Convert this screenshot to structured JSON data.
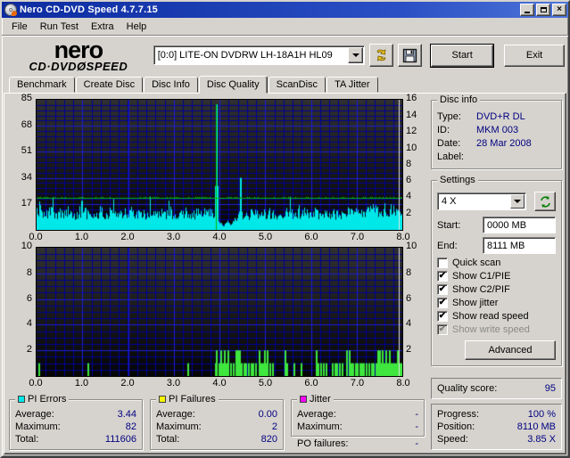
{
  "window": {
    "title": "Nero CD-DVD Speed 4.7.7.15"
  },
  "menu": {
    "items": [
      {
        "label": "File"
      },
      {
        "label": "Run Test"
      },
      {
        "label": "Extra"
      },
      {
        "label": "Help"
      }
    ]
  },
  "toolbar": {
    "logo_line1": "nero",
    "logo_line2": "CD·DVDØSPEED",
    "drive_selected": "[0:0]   LITE-ON DVDRW LH-18A1H HL09",
    "start_label": "Start",
    "exit_label": "Exit"
  },
  "tabs": [
    {
      "label": "Benchmark",
      "active": false
    },
    {
      "label": "Create Disc",
      "active": false
    },
    {
      "label": "Disc Info",
      "active": false
    },
    {
      "label": "Disc Quality",
      "active": true
    },
    {
      "label": "ScanDisc",
      "active": false
    },
    {
      "label": "TA Jitter",
      "active": false
    }
  ],
  "disc_info": {
    "title": "Disc info",
    "rows": [
      {
        "label": "Type:",
        "value": "DVD+R DL"
      },
      {
        "label": "ID:",
        "value": "MKM 003"
      },
      {
        "label": "Date:",
        "value": "28 Mar 2008"
      },
      {
        "label": "Label:",
        "value": ""
      }
    ]
  },
  "settings": {
    "title": "Settings",
    "speed_selected": "4 X",
    "start_label": "Start:",
    "start_value": "0000 MB",
    "end_label": "End:",
    "end_value": "8111 MB",
    "checkboxes": [
      {
        "label": "Quick scan",
        "state": "unchecked"
      },
      {
        "label": "Show C1/PIE",
        "state": "checked"
      },
      {
        "label": "Show C2/PIF",
        "state": "checked"
      },
      {
        "label": "Show jitter",
        "state": "checked"
      },
      {
        "label": "Show read speed",
        "state": "checked"
      },
      {
        "label": "Show write speed",
        "state": "checked-disabled"
      }
    ],
    "advanced_label": "Advanced"
  },
  "quality": {
    "label": "Quality score:",
    "value": "95"
  },
  "progress": {
    "rows": [
      {
        "label": "Progress:",
        "value": "100 %"
      },
      {
        "label": "Position:",
        "value": "8110 MB"
      },
      {
        "label": "Speed:",
        "value": "3.85 X"
      }
    ]
  },
  "stats": {
    "pi_errors": {
      "title": "PI Errors",
      "color": "#00e8e8",
      "rows": [
        {
          "label": "Average:",
          "value": "3.44"
        },
        {
          "label": "Maximum:",
          "value": "82"
        },
        {
          "label": "Total:",
          "value": "111606"
        }
      ]
    },
    "pi_failures": {
      "title": "PI Failures",
      "color": "#f5f500",
      "rows": [
        {
          "label": "Average:",
          "value": "0.00"
        },
        {
          "label": "Maximum:",
          "value": "2"
        },
        {
          "label": "Total:",
          "value": "820"
        }
      ]
    },
    "jitter": {
      "title": "Jitter",
      "color": "#f500f5",
      "rows": [
        {
          "label": "Average:",
          "value": "-"
        },
        {
          "label": "Maximum:",
          "value": "-"
        }
      ],
      "po_label": "PO failures:",
      "po_value": "-"
    }
  },
  "chart_data": [
    {
      "type": "area",
      "name": "PI Errors scan trace",
      "x": {
        "min": 0,
        "max": 8,
        "minor_step": 0.2,
        "major_step": 1,
        "tick_labels": [
          "0.0",
          "1.0",
          "2.0",
          "3.0",
          "4.0",
          "5.0",
          "6.0",
          "7.0",
          "8.0"
        ]
      },
      "y_left": {
        "max": 85,
        "minor_step": 3.4,
        "major_step": 17,
        "tick_labels": [
          "85",
          "68",
          "51",
          "34",
          "17"
        ]
      },
      "y_right": {
        "max": 16,
        "tick_labels": [
          "16",
          "14",
          "12",
          "10",
          "8",
          "6",
          "4",
          "2"
        ]
      },
      "noise": {
        "color": "#00e8e8",
        "x_step": 0.1,
        "jitter": 0.35,
        "samples": [
          10,
          11,
          9,
          12,
          10,
          11,
          10,
          12,
          9,
          11,
          13,
          10,
          11,
          9,
          12,
          10,
          11,
          12,
          10,
          11,
          10,
          12,
          9,
          11,
          10,
          12,
          10,
          11,
          9,
          12,
          10,
          11,
          10,
          12,
          9,
          11,
          10,
          11,
          12,
          11,
          4,
          3,
          4,
          5,
          9,
          10,
          9,
          11,
          10,
          11,
          10,
          11,
          9,
          11,
          10,
          12,
          10,
          11,
          10,
          12,
          10,
          11,
          10,
          12,
          10,
          11,
          9,
          11,
          12,
          10,
          11,
          10,
          11,
          12,
          13,
          12,
          13,
          12,
          13,
          12,
          13
        ]
      },
      "spikes": [
        {
          "x": 0.97,
          "value": 19
        },
        {
          "x": 3.93,
          "value": 82
        },
        {
          "x": 4.45,
          "value": 34
        }
      ],
      "speed_line": {
        "color": "#00bb00",
        "value_right_axis": 4
      },
      "vlines": [
        {
          "x": 3.93,
          "value": 82,
          "color": "#00bb00"
        },
        {
          "x": 7.92,
          "value": 85,
          "color": "#e6e6e6"
        }
      ]
    },
    {
      "type": "bar",
      "name": "PI Failures scan trace",
      "x": {
        "min": 0,
        "max": 8,
        "minor_step": 0.2,
        "major_step": 1,
        "tick_labels": [
          "0.0",
          "1.0",
          "2.0",
          "3.0",
          "4.0",
          "5.0",
          "6.0",
          "7.0",
          "8.0"
        ]
      },
      "y_left": {
        "max": 10,
        "minor_step": 0.5,
        "major_step": 2,
        "tick_labels": [
          "10",
          "8",
          "6",
          "4",
          "2"
        ]
      },
      "y_right": {
        "max": 10,
        "tick_labels": [
          "10",
          "8",
          "6",
          "4",
          "2"
        ]
      },
      "bars": {
        "color": "#3ee63e",
        "points": [
          [
            0.03,
            1
          ],
          [
            1.12,
            1
          ],
          [
            3.3,
            1
          ],
          [
            3.9,
            1
          ],
          [
            3.93,
            2
          ],
          [
            3.98,
            1
          ],
          [
            4.02,
            2
          ],
          [
            4.06,
            1
          ],
          [
            4.1,
            2
          ],
          [
            4.14,
            1
          ],
          [
            4.18,
            2
          ],
          [
            4.24,
            1
          ],
          [
            4.3,
            1
          ],
          [
            4.35,
            2
          ],
          [
            4.39,
            2
          ],
          [
            4.42,
            2
          ],
          [
            4.46,
            1
          ],
          [
            4.52,
            1
          ],
          [
            4.57,
            1
          ],
          [
            4.63,
            1
          ],
          [
            4.68,
            1
          ],
          [
            4.73,
            1
          ],
          [
            4.79,
            1
          ],
          [
            4.85,
            2
          ],
          [
            4.89,
            1
          ],
          [
            4.93,
            1
          ],
          [
            4.97,
            2
          ],
          [
            5.01,
            1
          ],
          [
            5.04,
            2
          ],
          [
            5.1,
            1
          ],
          [
            5.16,
            1
          ],
          [
            5.42,
            2
          ],
          [
            5.46,
            1
          ],
          [
            5.62,
            1
          ],
          [
            5.78,
            1
          ],
          [
            6.1,
            2
          ],
          [
            6.14,
            1
          ],
          [
            6.2,
            1
          ],
          [
            6.27,
            1
          ],
          [
            6.33,
            1
          ],
          [
            6.45,
            1
          ],
          [
            6.51,
            1
          ],
          [
            6.56,
            1
          ],
          [
            6.62,
            1
          ],
          [
            6.68,
            1
          ],
          [
            6.78,
            2
          ],
          [
            6.82,
            2
          ],
          [
            6.86,
            1
          ],
          [
            6.91,
            1
          ],
          [
            6.96,
            1
          ],
          [
            7.01,
            1
          ],
          [
            7.06,
            1
          ],
          [
            7.1,
            1
          ],
          [
            7.15,
            1
          ],
          [
            7.2,
            1
          ],
          [
            7.26,
            1
          ],
          [
            7.31,
            1
          ],
          [
            7.36,
            1
          ],
          [
            7.41,
            1
          ],
          [
            7.46,
            2
          ],
          [
            7.5,
            2
          ],
          [
            7.53,
            1
          ],
          [
            7.56,
            2
          ],
          [
            7.59,
            1
          ],
          [
            7.62,
            2
          ],
          [
            7.66,
            1
          ],
          [
            7.7,
            2
          ],
          [
            7.73,
            1
          ],
          [
            7.76,
            1
          ],
          [
            7.8,
            1
          ],
          [
            7.84,
            1
          ],
          [
            7.88,
            2
          ],
          [
            7.93,
            1
          ],
          [
            7.97,
            1
          ]
        ]
      },
      "vlines": [
        {
          "x": 7.92,
          "value": 10,
          "color": "#e6e6e6"
        }
      ]
    }
  ]
}
